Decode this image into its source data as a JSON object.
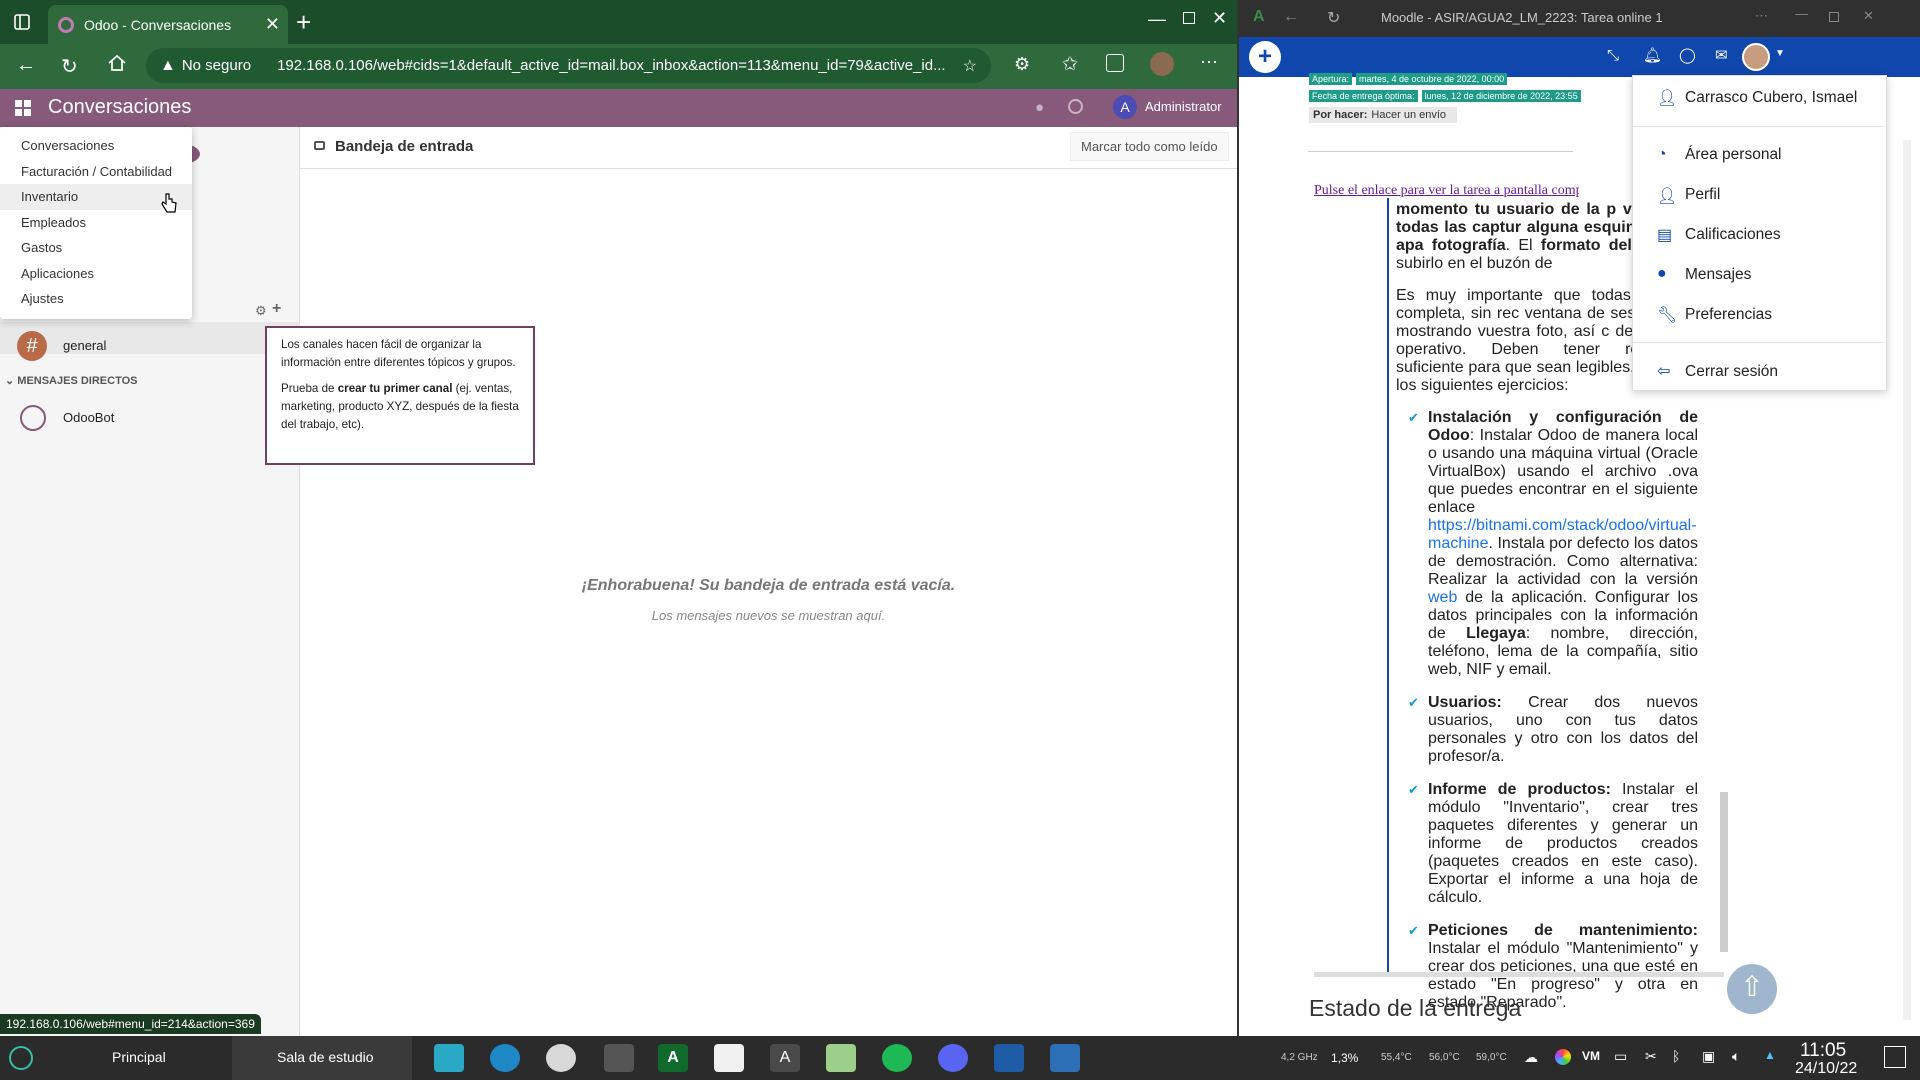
{
  "left_browser": {
    "tab_title": "Odoo - Conversaciones",
    "new_tab": "+",
    "security_label": "No seguro",
    "url": "192.168.0.106/web#cids=1&default_active_id=mail.box_inbox&action=113&menu_id=79&active_id...",
    "status_url": "192.168.0.106/web#menu_id=214&action=369"
  },
  "odoo": {
    "app_title": "Conversaciones",
    "user_initial": "A",
    "user_name": "Administrator",
    "inbox_title": "Bandeja de entrada",
    "mark_all_read": "Marcar todo como leído",
    "empty_title": "¡Enhorabuena! Su bandeja de entrada está vacía.",
    "empty_sub": "Los mensajes nuevos se muestran aquí.",
    "channel_general": "general",
    "direct_messages_header": "MENSAJES DIRECTOS",
    "odoobot": "OdooBot",
    "tooltip_p1": "Los canales hacen fácil de organizar la información entre diferentes tópicos y grupos.",
    "tooltip_p2_pre": "Prueba de ",
    "tooltip_p2_bold": "crear tu primer canal",
    "tooltip_p2_post": " (ej. ventas, marketing, producto XYZ, después de la fiesta del trabajo, etc).",
    "apps_menu": [
      "Conversaciones",
      "Facturación / Contabilidad",
      "Inventario",
      "Empleados",
      "Gastos",
      "Aplicaciones",
      "Ajustes"
    ]
  },
  "right_browser": {
    "window_title": "Moodle - ASIR/AGUA2_LM_2223: Tarea online 1",
    "opening_label": "Apertura:",
    "opening_date": "martes, 4 de octubre de 2022, 00:00",
    "due_label": "Fecha de entrega óptima:",
    "due_date": "lunes, 12 de diciembre de 2022, 23:55",
    "todo_label": "Por hacer:",
    "todo_value": "Hacer un envío",
    "fullscreen_link": "Pulse el enlace para ver la tarea a pantalla compl",
    "para1_bold": "momento tu usuario de la p visible en todas las captur alguna esquina donde apa fotografía",
    "para1_mid": ". El ",
    "para1_bold2": "formato del",
    "para1_end": "deberás subirlo en el buzón de",
    "para2": "Es muy importante que todas pantalla completa, sin rec ventana de sesión de la mostrando vuestra foto, así c del sistema operativo. Deben tener resolución suficiente para que sean legibles. Realizar los siguientes ejercicios:",
    "items": [
      {
        "bold": "Instalación y configuración de Odoo",
        "text": ": Instalar Odoo de manera local o usando una máquina virtual (Oracle VirtualBox) usando el archivo .ova que puedes encontrar en el siguiente enlace ",
        "link": "https://bitnami.com/stack/odoo/virtual-machine",
        "text2": ". Instala por defecto los datos de demostración. Como alternativa: Realizar la actividad con la versión ",
        "link2": "web ",
        "text3": "de la aplicación. Configurar los datos principales con la información de ",
        "bold2": "Llegaya",
        "text4": ": nombre, dirección, teléfono, lema de la compañía, sitio web, NIF y email."
      },
      {
        "bold": "Usuarios:",
        "text": " Crear dos nuevos usuarios, uno con tus datos personales y otro con los datos del profesor/a."
      },
      {
        "bold": "Informe de productos:",
        "text": " Instalar el módulo \"Inventario\", crear tres paquetes diferentes y generar un informe de productos creados (paquetes creados en este caso). Exportar el informe a una hoja de cálculo."
      },
      {
        "bold": "Peticiones de mantenimiento:",
        "text": " Instalar el módulo \"Mantenimiento\" y crear dos peticiones, una que esté en estado \"En progreso\" y otra en estado \"Reparado\"."
      }
    ],
    "submission_status": "Estado de la entrega",
    "user_menu": [
      "Carrasco Cubero, Ismael",
      "Área personal",
      "Perfil",
      "Calificaciones",
      "Mensajes",
      "Preferencias",
      "Cerrar sesión"
    ]
  },
  "taskbar": {
    "start_label": "Principal",
    "study_label": "Sala de estudio",
    "cpu_freq": "4,2 GHz",
    "cpu_usage": "1,3%",
    "temp1": "55,4°C",
    "temp2": "56,0°C",
    "temp3": "59,0°C",
    "time": "11:05",
    "date": "24/10/22"
  },
  "colors": {
    "odoo": "#875a7b",
    "edge_green": "#2f6a3d",
    "moodle_blue": "#0f47ad"
  }
}
